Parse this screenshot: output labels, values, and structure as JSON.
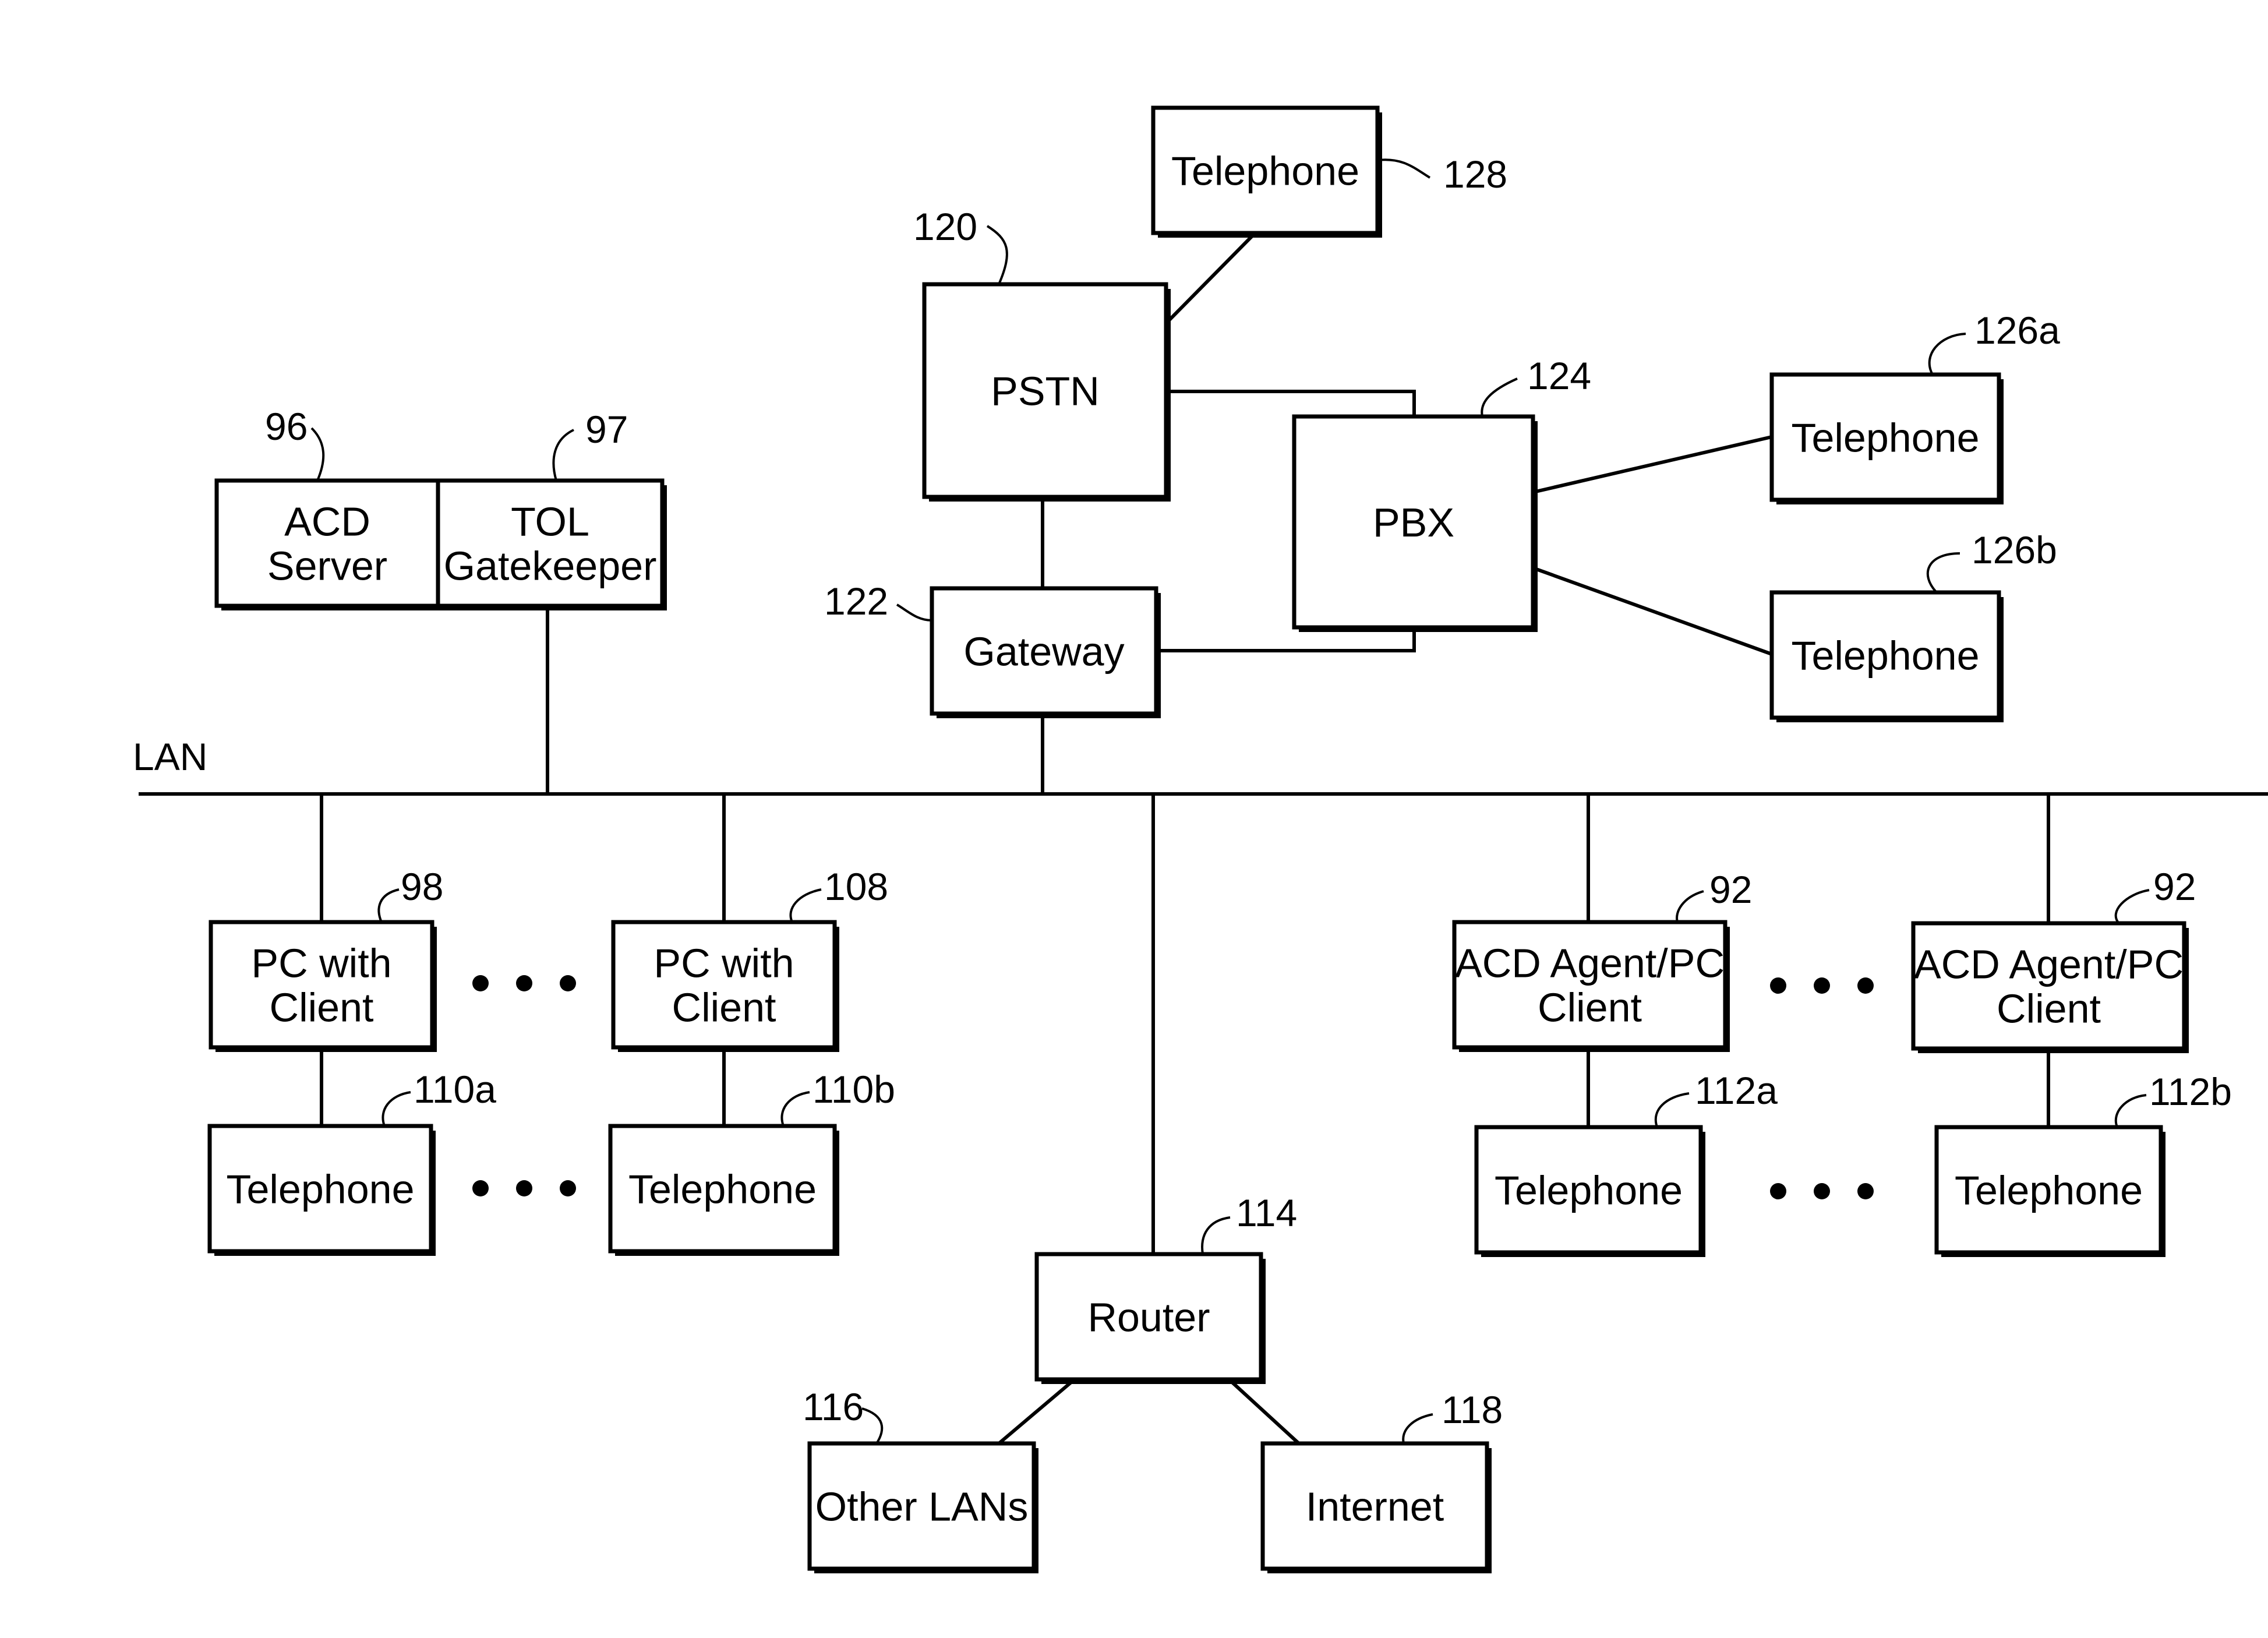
{
  "diagram": {
    "lan_label": "LAN",
    "nodes": {
      "telephone_128": {
        "label": [
          "Telephone"
        ],
        "ref": "128"
      },
      "pstn": {
        "label": [
          "PSTN"
        ],
        "ref": "120"
      },
      "pbx": {
        "label": [
          "PBX"
        ],
        "ref": "124"
      },
      "telephone_126a": {
        "label": [
          "Telephone"
        ],
        "ref": "126a"
      },
      "telephone_126b": {
        "label": [
          "Telephone"
        ],
        "ref": "126b"
      },
      "gateway": {
        "label": [
          "Gateway"
        ],
        "ref": "122"
      },
      "acd_server": {
        "label": [
          "ACD",
          "Server"
        ],
        "ref": "96"
      },
      "tol_gatekeeper": {
        "label": [
          "TOL",
          "Gatekeeper"
        ],
        "ref": "97"
      },
      "pc_client_98": {
        "label": [
          "PC with",
          "Client"
        ],
        "ref": "98"
      },
      "pc_client_108": {
        "label": [
          "PC with",
          "Client"
        ],
        "ref": "108"
      },
      "telephone_110a": {
        "label": [
          "Telephone"
        ],
        "ref": "110a"
      },
      "telephone_110b": {
        "label": [
          "Telephone"
        ],
        "ref": "110b"
      },
      "router": {
        "label": [
          "Router"
        ],
        "ref": "114"
      },
      "other_lans": {
        "label": [
          "Other LANs"
        ],
        "ref": "116"
      },
      "internet": {
        "label": [
          "Internet"
        ],
        "ref": "118"
      },
      "acd_agent_1": {
        "label": [
          "ACD Agent/PC",
          "Client"
        ],
        "ref": "92"
      },
      "acd_agent_2": {
        "label": [
          "ACD Agent/PC",
          "Client"
        ],
        "ref": "92"
      },
      "telephone_112a": {
        "label": [
          "Telephone"
        ],
        "ref": "112a"
      },
      "telephone_112b": {
        "label": [
          "Telephone"
        ],
        "ref": "112b"
      }
    }
  }
}
